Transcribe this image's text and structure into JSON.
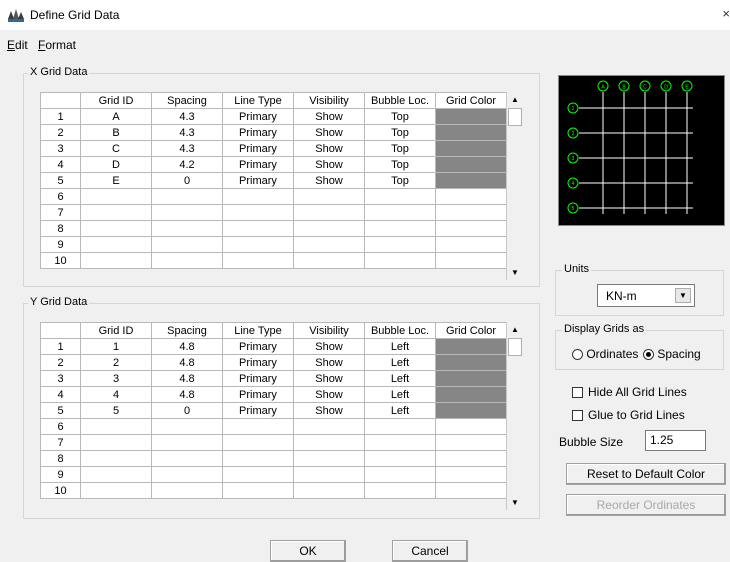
{
  "window": {
    "title": "Define Grid Data",
    "close_glyph": "×"
  },
  "menu": {
    "edit": {
      "mnemonic": "E",
      "rest": "dit"
    },
    "format": {
      "mnemonic": "F",
      "rest": "ormat"
    }
  },
  "x_grid": {
    "legend": "X Grid Data",
    "headers": [
      "",
      "Grid ID",
      "Spacing",
      "Line Type",
      "Visibility",
      "Bubble Loc.",
      "Grid Color"
    ],
    "rows": [
      {
        "n": "1",
        "id": "A",
        "spacing": "4.3",
        "type": "Primary",
        "vis": "Show",
        "bubble": "Top",
        "color": true
      },
      {
        "n": "2",
        "id": "B",
        "spacing": "4.3",
        "type": "Primary",
        "vis": "Show",
        "bubble": "Top",
        "color": true
      },
      {
        "n": "3",
        "id": "C",
        "spacing": "4.3",
        "type": "Primary",
        "vis": "Show",
        "bubble": "Top",
        "color": true
      },
      {
        "n": "4",
        "id": "D",
        "spacing": "4.2",
        "type": "Primary",
        "vis": "Show",
        "bubble": "Top",
        "color": true
      },
      {
        "n": "5",
        "id": "E",
        "spacing": "0",
        "type": "Primary",
        "vis": "Show",
        "bubble": "Top",
        "color": true
      },
      {
        "n": "6",
        "id": "",
        "spacing": "",
        "type": "",
        "vis": "",
        "bubble": "",
        "color": false
      },
      {
        "n": "7",
        "id": "",
        "spacing": "",
        "type": "",
        "vis": "",
        "bubble": "",
        "color": false
      },
      {
        "n": "8",
        "id": "",
        "spacing": "",
        "type": "",
        "vis": "",
        "bubble": "",
        "color": false
      },
      {
        "n": "9",
        "id": "",
        "spacing": "",
        "type": "",
        "vis": "",
        "bubble": "",
        "color": false
      },
      {
        "n": "10",
        "id": "",
        "spacing": "",
        "type": "",
        "vis": "",
        "bubble": "",
        "color": false
      }
    ]
  },
  "y_grid": {
    "legend": "Y Grid Data",
    "headers": [
      "",
      "Grid ID",
      "Spacing",
      "Line Type",
      "Visibility",
      "Bubble Loc.",
      "Grid Color"
    ],
    "rows": [
      {
        "n": "1",
        "id": "1",
        "spacing": "4.8",
        "type": "Primary",
        "vis": "Show",
        "bubble": "Left",
        "color": true
      },
      {
        "n": "2",
        "id": "2",
        "spacing": "4.8",
        "type": "Primary",
        "vis": "Show",
        "bubble": "Left",
        "color": true
      },
      {
        "n": "3",
        "id": "3",
        "spacing": "4.8",
        "type": "Primary",
        "vis": "Show",
        "bubble": "Left",
        "color": true
      },
      {
        "n": "4",
        "id": "4",
        "spacing": "4.8",
        "type": "Primary",
        "vis": "Show",
        "bubble": "Left",
        "color": true
      },
      {
        "n": "5",
        "id": "5",
        "spacing": "0",
        "type": "Primary",
        "vis": "Show",
        "bubble": "Left",
        "color": true
      },
      {
        "n": "6",
        "id": "",
        "spacing": "",
        "type": "",
        "vis": "",
        "bubble": "",
        "color": false
      },
      {
        "n": "7",
        "id": "",
        "spacing": "",
        "type": "",
        "vis": "",
        "bubble": "",
        "color": false
      },
      {
        "n": "8",
        "id": "",
        "spacing": "",
        "type": "",
        "vis": "",
        "bubble": "",
        "color": false
      },
      {
        "n": "9",
        "id": "",
        "spacing": "",
        "type": "",
        "vis": "",
        "bubble": "",
        "color": false
      },
      {
        "n": "10",
        "id": "",
        "spacing": "",
        "type": "",
        "vis": "",
        "bubble": "",
        "color": false
      }
    ]
  },
  "preview": {
    "x_bubbles": [
      "A",
      "B",
      "C",
      "D",
      "E"
    ],
    "y_bubbles": [
      "1",
      "2",
      "3",
      "4",
      "5"
    ],
    "line_color": "#ffffff",
    "bubble_color": "#00ff00"
  },
  "units": {
    "caption": "Units",
    "selected": "KN-m"
  },
  "display": {
    "caption": "Display Grids as",
    "ordinates": "Ordinates",
    "spacing": "Spacing",
    "selected": "spacing"
  },
  "options": {
    "hide_all": "Hide All Grid Lines",
    "glue": "Glue to Grid Lines",
    "bubble_size_label": "Bubble Size",
    "bubble_size_value": "1.25"
  },
  "buttons": {
    "reset_color": "Reset to Default Color",
    "reorder": "Reorder Ordinates",
    "ok": "OK",
    "cancel": "Cancel"
  },
  "colors": {
    "grid_color_fill": "#868686",
    "dialog_bg": "#f0f0f0"
  }
}
